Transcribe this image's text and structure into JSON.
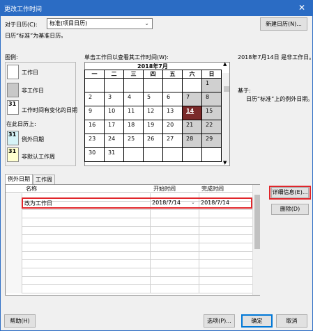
{
  "window": {
    "title": "更改工作时间",
    "close_glyph": "✕"
  },
  "calendar_for": {
    "label": "对于日历(C):",
    "value": "标准(项目日历)"
  },
  "new_calendar_button": "新建日历(N)...",
  "base_calendar_note": "日历“标准”为基准日历。",
  "legend": {
    "title": "图例:",
    "working": "工作日",
    "nonworking": "非工作日",
    "changed": "工作时间有变化的日期",
    "on_this_calendar": "在此日历上:",
    "exception": "例外日期",
    "nondefault_week": "非默认工作周",
    "swatch_number": "31"
  },
  "calendar": {
    "instruction": "单击工作日以查看其工作时间(W):",
    "month_title": "2018年7月",
    "weekdays": [
      "一",
      "二",
      "三",
      "四",
      "五",
      "六",
      "日"
    ],
    "weeks": [
      [
        "",
        "",
        "",
        "",
        "",
        "",
        "1"
      ],
      [
        "2",
        "3",
        "4",
        "5",
        "6",
        "7",
        "8"
      ],
      [
        "9",
        "10",
        "11",
        "12",
        "13",
        "14",
        "15"
      ],
      [
        "16",
        "17",
        "18",
        "19",
        "20",
        "21",
        "22"
      ],
      [
        "23",
        "24",
        "25",
        "26",
        "27",
        "28",
        "29"
      ],
      [
        "30",
        "31",
        "",
        "",
        "",
        "",
        ""
      ]
    ],
    "selected_day": "14"
  },
  "day_info": {
    "status": "2018年7月14日 是非工作日。",
    "based_on": "基于:",
    "based_on_detail": "日历“标准”上的例外日期。"
  },
  "tabs": [
    "例外日期",
    "工作周"
  ],
  "grid": {
    "columns": [
      "名称",
      "开始时间",
      "完成时间"
    ],
    "rows": [
      {
        "name": "改为工作日",
        "start": "2018/7/14",
        "finish": "2018/7/14"
      }
    ]
  },
  "details_button": "详细信息(E)...",
  "delete_button": "删除(D)",
  "help_button": "帮助(H)",
  "options_button": "选项(P)...",
  "ok_button": "确定",
  "cancel_button": "取消",
  "colors": {
    "title_bar": "#2b6cc4",
    "selected_day": "#7b2a2a",
    "highlight": "#e0262b",
    "nonworking": "#d0d0d0"
  }
}
